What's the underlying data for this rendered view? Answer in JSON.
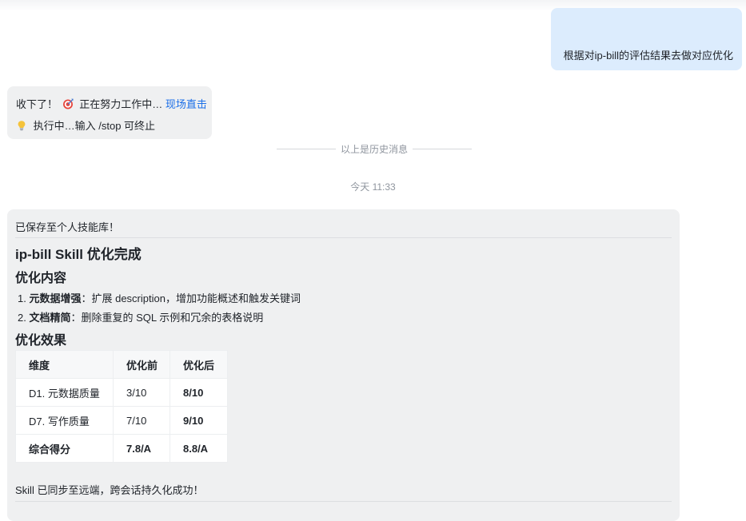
{
  "user_message": {
    "text": "根据对ip-bill的评估结果去做对应优化"
  },
  "bot_status": {
    "line1_prefix": "收下了！",
    "line1_middle": "正在努力工作中…",
    "line1_link": "现场直击",
    "line2": "执行中…输入 /stop 可终止",
    "icons": [
      "target-emoji-icon",
      "lightbulb-emoji-icon"
    ]
  },
  "history_divider": "以上是历史消息",
  "timestamp": "今天 11:33",
  "result_card": {
    "saved_notice": "已保存至个人技能库！",
    "title": "ip-bill Skill 优化完成",
    "section1": "优化内容",
    "items": [
      {
        "num": "1.",
        "bold": "元数据增强",
        "rest": "：扩展 description，增加功能概述和触发关键词"
      },
      {
        "num": "2.",
        "bold": "文档精简",
        "rest": "：删除重复的 SQL 示例和冗余的表格说明"
      }
    ],
    "section2": "优化效果",
    "table": {
      "headers": [
        "维度",
        "优化前",
        "优化后"
      ],
      "rows": [
        [
          "D1. 元数据质量",
          "3/10",
          "8/10"
        ],
        [
          "D7. 写作质量",
          "7/10",
          "9/10"
        ],
        [
          "综合得分",
          "7.8/A",
          "8.8/A"
        ]
      ]
    },
    "sync_notice": "Skill 已同步至远端，跨会话持久化成功！"
  }
}
